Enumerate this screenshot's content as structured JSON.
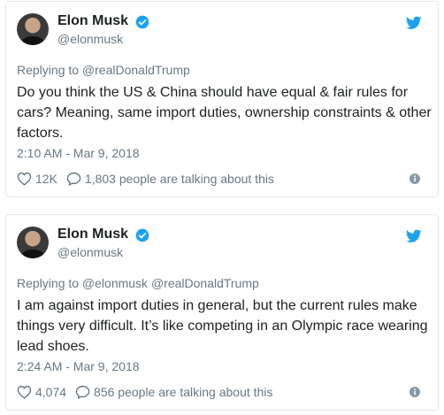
{
  "colors": {
    "twitter_blue": "#1da1f2",
    "secondary_text": "#697882",
    "primary_text": "#1c2022",
    "border": "#e1e8ed"
  },
  "tweets": [
    {
      "author_name": "Elon Musk",
      "handle": "@elonmusk",
      "verified_icon": "verified-badge-icon",
      "reply_line": "Replying to @realDonaldTrump",
      "text": "Do you think the US & China should have equal & fair rules for cars? Meaning, same import duties, ownership constraints & other factors.",
      "timestamp": "2:10 AM - Mar 9, 2018",
      "likes": "12K",
      "talking": "1,803 people are talking about this"
    },
    {
      "author_name": "Elon Musk",
      "handle": "@elonmusk",
      "verified_icon": "verified-badge-icon",
      "reply_line": "Replying to @elonmusk @realDonaldTrump",
      "text": "I am against import duties in general, but the current rules make things very difficult. It’s like competing in an Olympic race wearing lead shoes.",
      "timestamp": "2:24 AM - Mar 9, 2018",
      "likes": "4,074",
      "talking": "856 people are talking about this"
    }
  ]
}
